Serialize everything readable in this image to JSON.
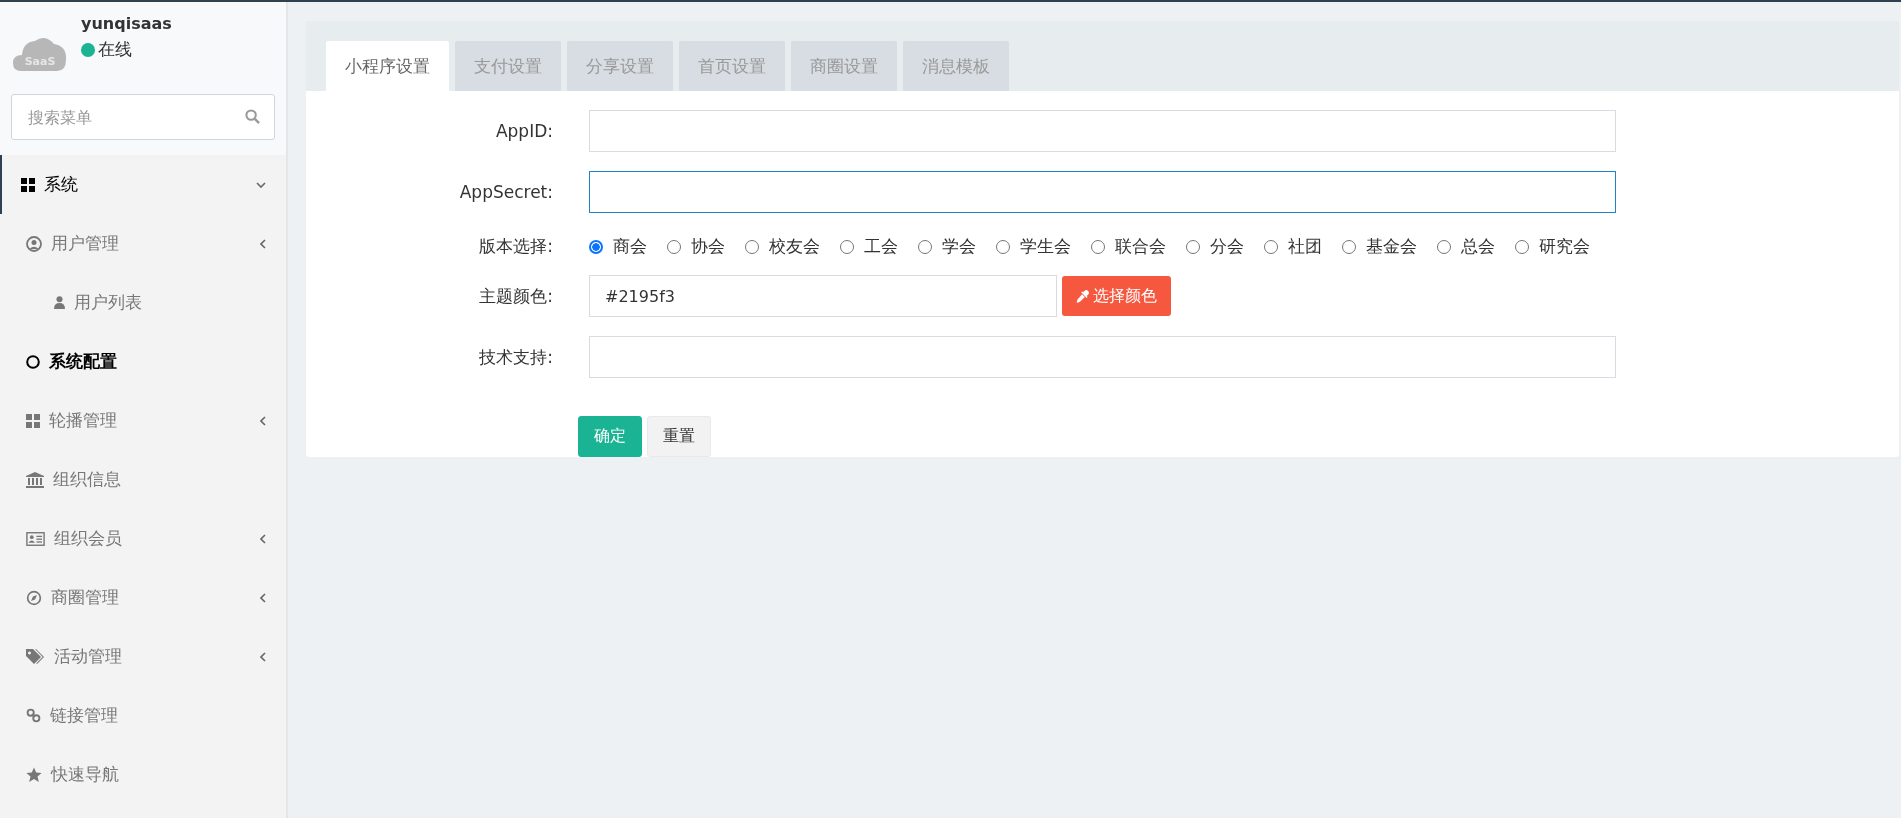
{
  "sidebar": {
    "user": {
      "name": "yunqisaas",
      "logo_text": "SaaS",
      "status": "在线"
    },
    "search": {
      "placeholder": "搜索菜单"
    },
    "menu": [
      {
        "label": "系统",
        "expanded": true,
        "selected": false,
        "children": [
          {
            "label": "用户管理",
            "expanded": false,
            "selected": false,
            "children": [
              {
                "label": "用户列表",
                "selected": false
              }
            ]
          },
          {
            "label": "系统配置",
            "selected": true
          }
        ]
      },
      {
        "label": "轮播管理",
        "expanded": false,
        "selected": false
      },
      {
        "label": "组织信息",
        "selected": false
      },
      {
        "label": "组织会员",
        "expanded": false,
        "selected": false
      },
      {
        "label": "商圈管理",
        "expanded": false,
        "selected": false
      },
      {
        "label": "活动管理",
        "expanded": false,
        "selected": false
      },
      {
        "label": "链接管理",
        "selected": false
      },
      {
        "label": "快速导航",
        "selected": false
      }
    ]
  },
  "tabs": [
    {
      "label": "小程序设置",
      "selected": true
    },
    {
      "label": "支付设置",
      "selected": false
    },
    {
      "label": "分享设置",
      "selected": false
    },
    {
      "label": "首页设置",
      "selected": false
    },
    {
      "label": "商圈设置",
      "selected": false
    },
    {
      "label": "消息模板",
      "selected": false
    }
  ],
  "form": {
    "fields": [
      {
        "kind": "text",
        "label": "AppID:",
        "focused": false
      },
      {
        "kind": "text",
        "label": "AppSecret:",
        "focused": true
      },
      {
        "kind": "radio",
        "label": "版本选择:",
        "options": [
          {
            "label": "商会",
            "selected": true
          },
          {
            "label": "协会",
            "selected": false
          },
          {
            "label": "校友会",
            "selected": false
          },
          {
            "label": "工会",
            "selected": false
          },
          {
            "label": "学会",
            "selected": false
          },
          {
            "label": "学生会",
            "selected": false
          },
          {
            "label": "联合会",
            "selected": false
          },
          {
            "label": "分会",
            "selected": false
          },
          {
            "label": "社团",
            "selected": false
          },
          {
            "label": "基金会",
            "selected": false
          },
          {
            "label": "总会",
            "selected": false
          },
          {
            "label": "研究会",
            "selected": false
          }
        ]
      },
      {
        "kind": "color",
        "label": "主题颜色:",
        "value": "#2195f3",
        "focused": false,
        "button": "选择颜色"
      },
      {
        "kind": "text",
        "label": "技术支持:",
        "focused": false
      }
    ],
    "buttons": [
      {
        "kind": "primary",
        "label": "确定"
      },
      {
        "kind": "default",
        "label": "重置"
      }
    ]
  }
}
